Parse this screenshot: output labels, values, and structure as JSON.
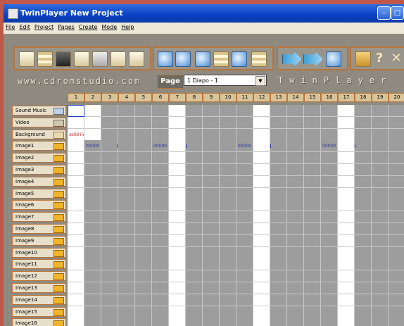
{
  "window": {
    "title": "TwinPlayer New Project"
  },
  "menu": [
    "File",
    "Edit",
    "Project",
    "Pages",
    "Create",
    "Mode",
    "Help"
  ],
  "toolbar": {
    "site": "www.cdromstudio.com",
    "page_label": "Page",
    "page_value": "1 Diapo - 1",
    "brand": "TwinPlayer"
  },
  "columns": [
    "1",
    "2",
    "3",
    "4",
    "5",
    "6",
    "7",
    "8",
    "9",
    "10",
    "11",
    "12",
    "13",
    "14",
    "15",
    "16",
    "17",
    "18",
    "19",
    "20"
  ],
  "rows": [
    "Sound Music",
    "Video",
    "Background",
    "Image1",
    "Image2",
    "Image3",
    "Image4",
    "Image5",
    "Image6",
    "Image7",
    "Image8",
    "Image9",
    "Image10",
    "Image11",
    "Image12",
    "Image13",
    "Image14",
    "Image15",
    "Image16"
  ],
  "cells": {
    "background_text": "solid in",
    "image1_marker": "00000"
  }
}
